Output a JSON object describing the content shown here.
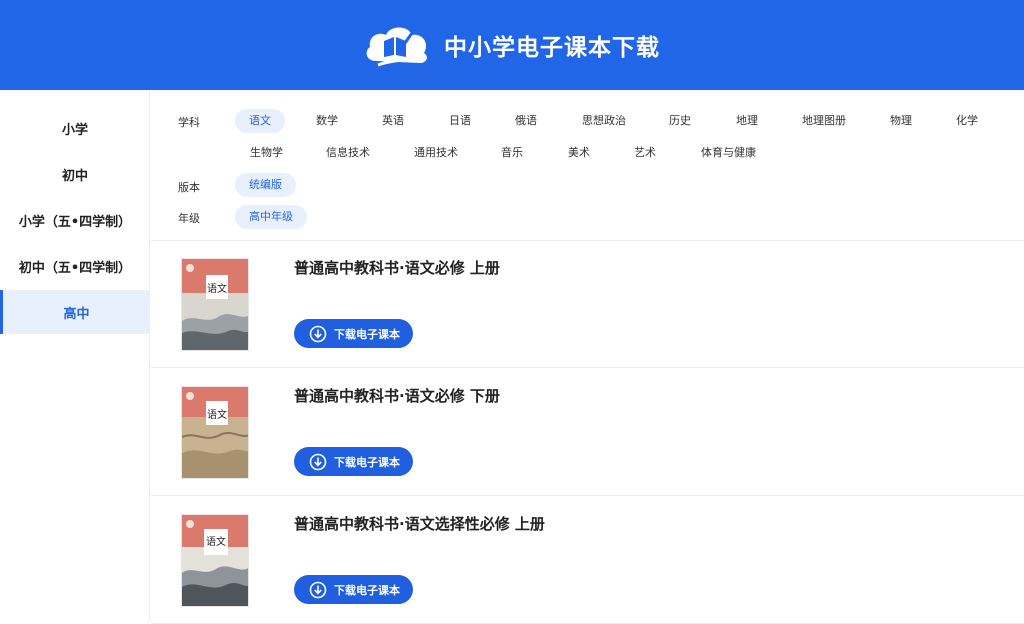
{
  "header": {
    "title": "中小学电子课本下载"
  },
  "sidebar": {
    "items": [
      {
        "label": "小学"
      },
      {
        "label": "初中"
      },
      {
        "label": "小学（五•四学制）"
      },
      {
        "label": "初中（五•四学制）"
      },
      {
        "label": "高中",
        "active": true
      }
    ]
  },
  "filters": {
    "subject": {
      "label": "学科",
      "options": [
        "语文",
        "数学",
        "英语",
        "日语",
        "俄语",
        "思想政治",
        "历史",
        "地理",
        "地理图册",
        "物理",
        "化学",
        "生物学",
        "信息技术",
        "通用技术",
        "音乐",
        "美术",
        "艺术",
        "体育与健康"
      ],
      "selected": "语文"
    },
    "edition": {
      "label": "版本",
      "options": [
        "统编版"
      ],
      "selected": "统编版"
    },
    "grade": {
      "label": "年级",
      "options": [
        "高中年级"
      ],
      "selected": "高中年级"
    }
  },
  "books": [
    {
      "title": "普通高中教科书·语文必修 上册",
      "button": "下载电子课本"
    },
    {
      "title": "普通高中教科书·语文必修 下册",
      "button": "下载电子课本"
    },
    {
      "title": "普通高中教科书·语文选择性必修 上册",
      "button": "下载电子课本"
    }
  ],
  "covers": [
    "语文",
    "语文",
    "语文"
  ],
  "colors": {
    "brand": "#2266e8",
    "selected_bg": "#e9f0fd",
    "button": "#1f5fe0"
  }
}
